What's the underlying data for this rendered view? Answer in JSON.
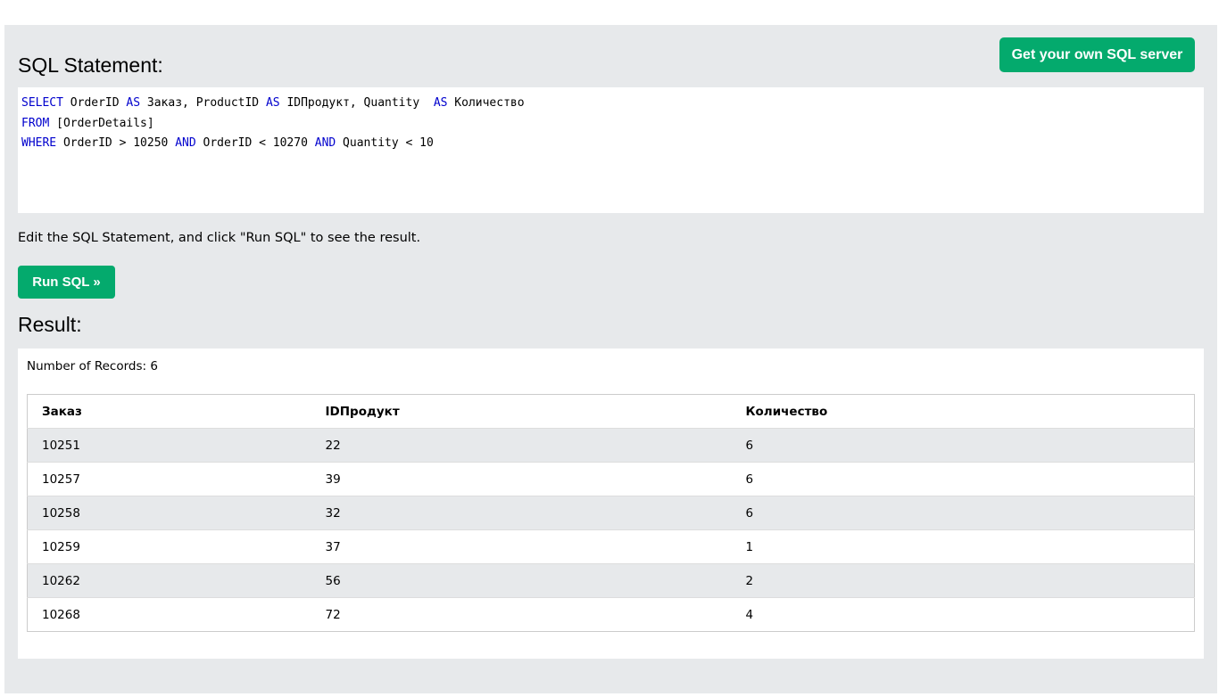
{
  "header": {
    "title": "SQL Statement:",
    "own_server_button": "Get your own SQL server"
  },
  "editor": {
    "lines": [
      [
        {
          "t": "SELECT",
          "kw": true
        },
        {
          "t": " OrderID ",
          "kw": false
        },
        {
          "t": "AS",
          "kw": true
        },
        {
          "t": " Заказ, ProductID ",
          "kw": false
        },
        {
          "t": "AS",
          "kw": true
        },
        {
          "t": " IDПродукт, Quantity  ",
          "kw": false
        },
        {
          "t": "AS",
          "kw": true
        },
        {
          "t": " Количество",
          "kw": false
        }
      ],
      [
        {
          "t": "FROM",
          "kw": true
        },
        {
          "t": " [OrderDetails]",
          "kw": false
        }
      ],
      [
        {
          "t": "WHERE",
          "kw": true
        },
        {
          "t": " OrderID > 10250 ",
          "kw": false
        },
        {
          "t": "AND",
          "kw": true
        },
        {
          "t": " OrderID < 10270 ",
          "kw": false
        },
        {
          "t": "AND",
          "kw": true
        },
        {
          "t": " Quantity < 10",
          "kw": false
        }
      ]
    ],
    "keyword_color": "#0000cd"
  },
  "hint_text": "Edit the SQL Statement, and click \"Run SQL\" to see the result.",
  "run_button": "Run SQL »",
  "result": {
    "title": "Result:",
    "record_count": "Number of Records: 6",
    "columns": [
      "Заказ",
      "IDПродукт",
      "Количество"
    ],
    "rows": [
      [
        "10251",
        "22",
        "6"
      ],
      [
        "10257",
        "39",
        "6"
      ],
      [
        "10258",
        "32",
        "6"
      ],
      [
        "10259",
        "37",
        "1"
      ],
      [
        "10262",
        "56",
        "2"
      ],
      [
        "10268",
        "72",
        "4"
      ]
    ]
  },
  "colors": {
    "accent_green": "#04aa6d",
    "panel_gray": "#e7e9eb"
  }
}
